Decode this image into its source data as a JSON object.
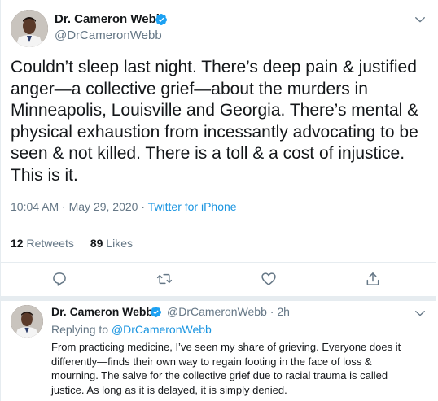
{
  "main_tweet": {
    "author_name": "Dr. Cameron Webb",
    "author_handle": "@DrCameronWebb",
    "text": "Couldn’t sleep last night. There’s deep pain & justified anger—a collective grief—about the murders in Minneapolis, Louisville and Georgia. There’s mental & physical exhaustion from incessantly advocating to be seen & not killed. There is a toll & a cost of injustice. This is it.",
    "timestamp": "10:04 AM · May 29, 2020 · ",
    "source": "Twitter for iPhone",
    "retweets_count": "12",
    "retweets_label": "Retweets",
    "likes_count": "89",
    "likes_label": "Likes"
  },
  "reply_tweet": {
    "author_name": "Dr. Cameron Webb",
    "author_handle": "@DrCameronWebb",
    "time_ago": "· 2h",
    "replying_to_label": "Replying to ",
    "replying_to_handle": "@DrCameronWebb",
    "text": "From practicing medicine, I’ve seen my share of grieving. Everyone does it differently—finds their own way to regain footing in the face of loss & mourning. The salve for the collective grief due to racial trauma is called justice. As long as it is delayed, it is simply denied."
  },
  "icons": [
    "verified-badge-icon",
    "chevron-down-icon",
    "reply-icon",
    "retweet-icon",
    "like-icon",
    "share-icon"
  ],
  "colors": {
    "accent": "#1b95e0",
    "text": "#14171a",
    "muted": "#657786",
    "border": "#e6ecf0"
  }
}
